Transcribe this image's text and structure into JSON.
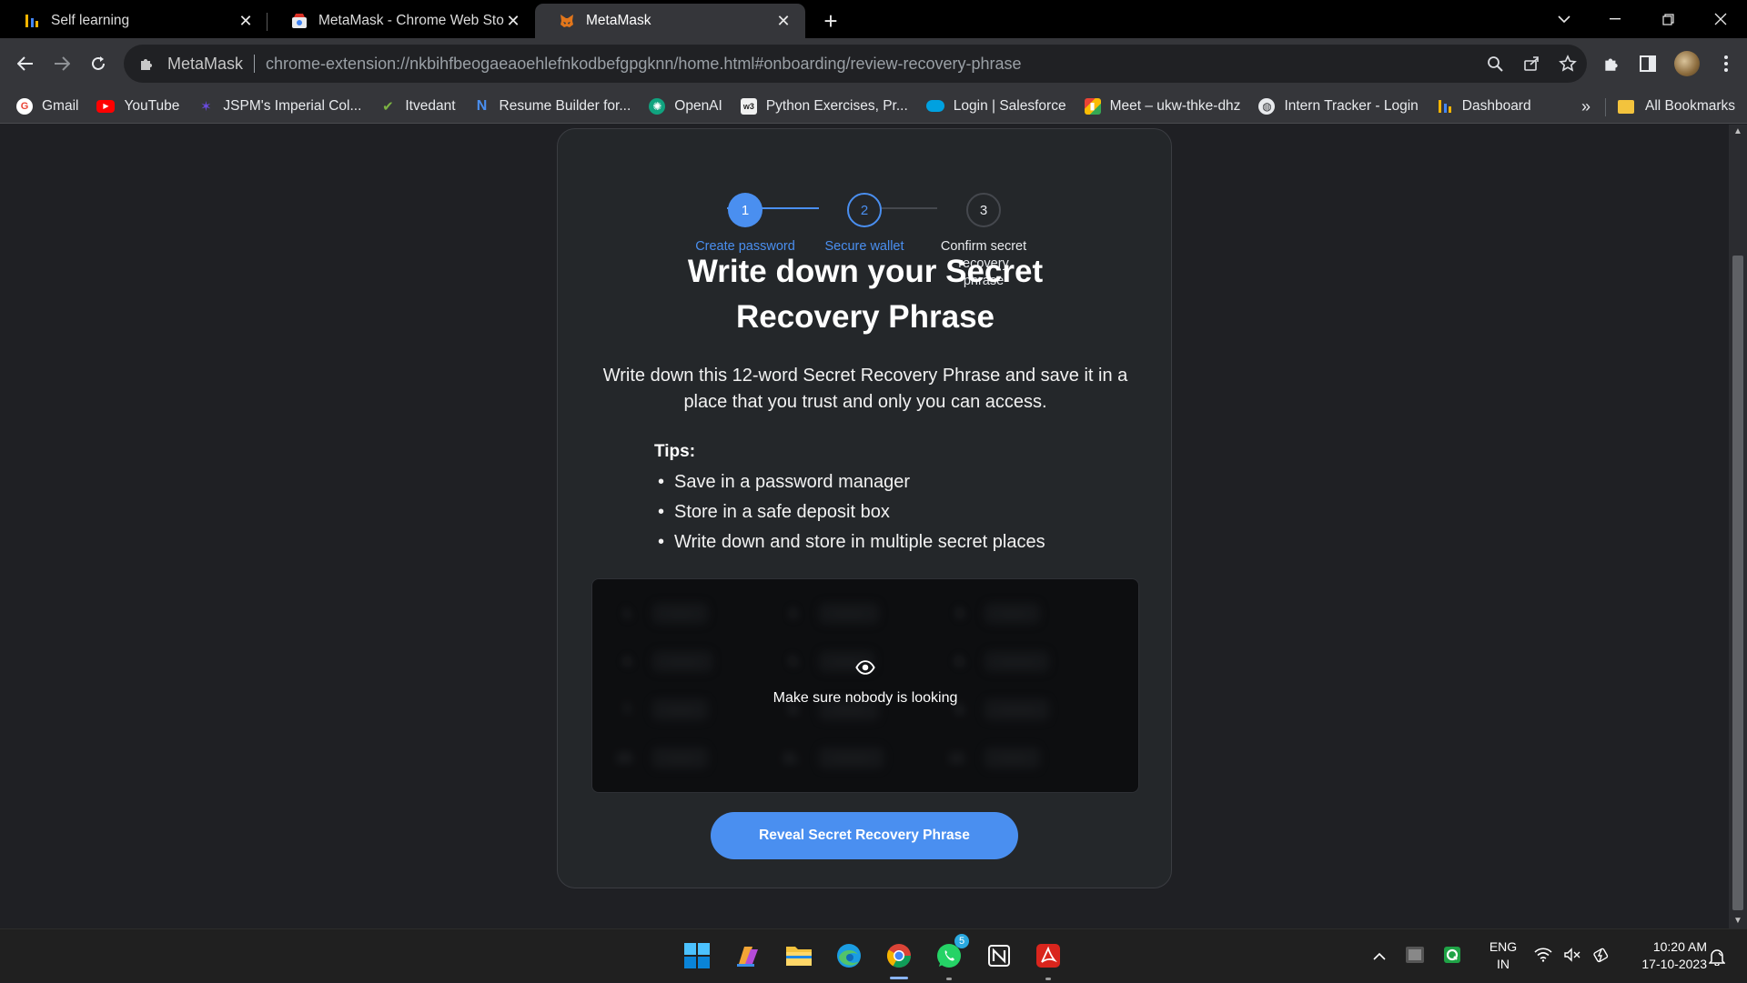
{
  "tabs": [
    {
      "title": "Self learning",
      "icon": "stats-icon"
    },
    {
      "title": "MetaMask - Chrome Web Store",
      "icon": "webstore-icon"
    },
    {
      "title": "MetaMask",
      "icon": "metamask-fox-icon",
      "active": true
    }
  ],
  "omnibox": {
    "site_name": "MetaMask",
    "url": "chrome-extension://nkbihfbeogaeaoehlefnkodbefgpgknn/home.html#onboarding/review-recovery-phrase"
  },
  "bookmarks": [
    {
      "label": "Gmail",
      "icon": "gmail-icon",
      "color": "#ea4335"
    },
    {
      "label": "YouTube",
      "icon": "youtube-icon",
      "color": "#ff0000"
    },
    {
      "label": "JSPM's Imperial Col...",
      "icon": "jspm-icon",
      "color": "#5b3bd6"
    },
    {
      "label": "Itvedant",
      "icon": "itvedant-icon",
      "color": "#7cb342"
    },
    {
      "label": "Resume Builder for...",
      "icon": "resume-icon",
      "color": "#3f7ad6"
    },
    {
      "label": "OpenAI",
      "icon": "openai-icon",
      "color": "#10a37f"
    },
    {
      "label": "Python Exercises, Pr...",
      "icon": "w3-icon",
      "color": "#f0f0f0"
    },
    {
      "label": "Login | Salesforce",
      "icon": "salesforce-icon",
      "color": "#00a1e0"
    },
    {
      "label": "Meet – ukw-thke-dhz",
      "icon": "meet-icon",
      "color": "#00897b"
    },
    {
      "label": "Intern Tracker - Login",
      "icon": "globe-icon",
      "color": "#e8eaed"
    },
    {
      "label": "Dashboard",
      "icon": "stats-icon",
      "color": "#f4b400"
    }
  ],
  "bookmarks_all": "All Bookmarks",
  "onboarding": {
    "steps": [
      {
        "number": "1",
        "label": "Create password",
        "state": "complete"
      },
      {
        "number": "2",
        "label": "Secure wallet",
        "state": "current"
      },
      {
        "number": "3",
        "label": "Confirm secret recovery phrase",
        "state": "pending"
      }
    ],
    "title": "Write down your Secret Recovery Phrase",
    "description": "Write down this 12-word Secret Recovery Phrase and save it in a place that you trust and only you can access.",
    "tips_title": "Tips:",
    "tips": [
      "Save in a password manager",
      "Store in a safe deposit box",
      "Write down and store in multiple secret places"
    ],
    "hidden_notice": "Make sure nobody is looking",
    "reveal_button": "Reveal Secret Recovery Phrase"
  },
  "colors": {
    "accent": "#4a8ff0",
    "page_bg": "#1f2024",
    "card_bg": "#24272a"
  },
  "taskbar": {
    "apps": [
      "windows-start-icon",
      "copilot-icon",
      "file-explorer-icon",
      "edge-icon",
      "chrome-icon",
      "whatsapp-icon",
      "notion-icon",
      "acrobat-icon"
    ],
    "whatsapp_badge": "5",
    "language_line1": "ENG",
    "language_line2": "IN",
    "time": "10:20 AM",
    "date": "17-10-2023"
  }
}
